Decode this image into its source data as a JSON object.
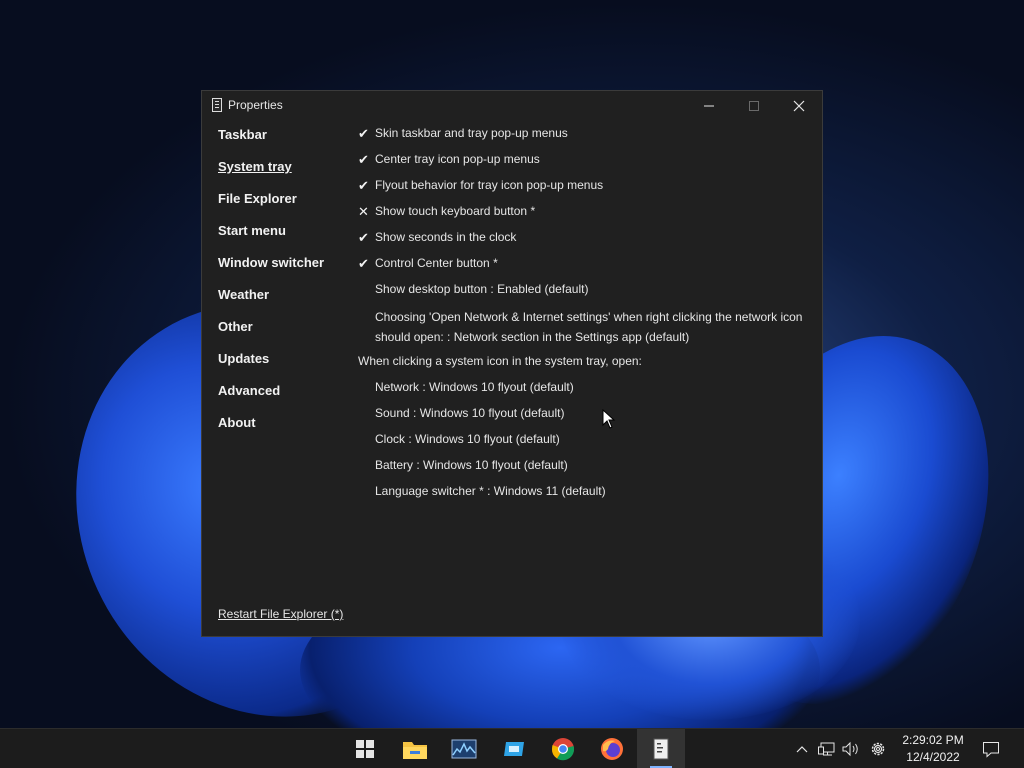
{
  "window": {
    "title": "Properties",
    "nav": [
      "Taskbar",
      "System tray",
      "File Explorer",
      "Start menu",
      "Window switcher",
      "Weather",
      "Other",
      "Updates",
      "Advanced",
      "About"
    ],
    "active_nav": "System tray",
    "options": [
      {
        "mark": "✔",
        "label": "Skin taskbar and tray pop-up menus"
      },
      {
        "mark": "✔",
        "label": "Center tray icon pop-up menus"
      },
      {
        "mark": "✔",
        "label": "Flyout behavior for tray icon pop-up menus"
      },
      {
        "mark": "✕",
        "label": "Show touch keyboard button *"
      },
      {
        "mark": "✔",
        "label": "Show seconds in the clock"
      },
      {
        "mark": "✔",
        "label": "Control Center button *"
      },
      {
        "mark": "",
        "label": "Show desktop button : Enabled (default)"
      },
      {
        "mark": "",
        "label": "Choosing 'Open Network & Internet settings' when right clicking the network icon should open: : Network section in the Settings app (default)"
      }
    ],
    "section_heading": "When clicking a system icon in the system tray, open:",
    "sub_options": [
      "Network : Windows 10 flyout (default)",
      "Sound : Windows 10 flyout (default)",
      "Clock : Windows 10 flyout (default)",
      "Battery : Windows 10 flyout (default)",
      "Language switcher * : Windows 11 (default)"
    ],
    "restart_link": "Restart File Explorer (*)"
  },
  "taskbar": {
    "apps": [
      "start-icon",
      "file-explorer-icon",
      "resource-monitor-icon",
      "app-icon",
      "chrome-icon",
      "firefox-icon",
      "properties-icon"
    ],
    "clock_time": "2:29:02 PM",
    "clock_date": "12/4/2022"
  }
}
